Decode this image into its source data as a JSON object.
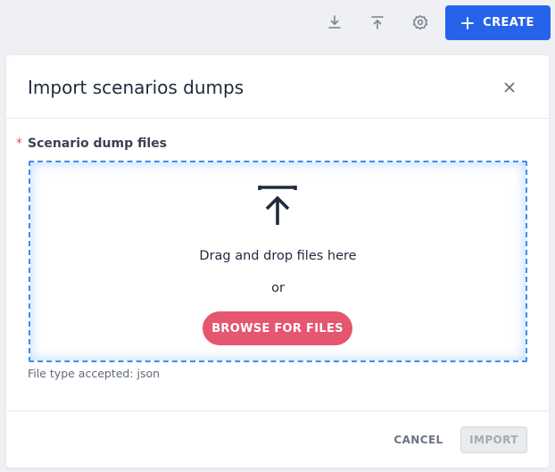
{
  "toolbar": {
    "download_icon": "download-icon",
    "upload_icon": "upload-icon",
    "settings_icon": "settings-icon",
    "create_label": "CREATE"
  },
  "dialog": {
    "title": "Import scenarios dumps",
    "field_label": "Scenario dump files",
    "required_marker": "*",
    "dropzone": {
      "drag_text": "Drag and drop files here",
      "or_text": "or",
      "browse_label": "BROWSE FOR FILES"
    },
    "hint": "File type accepted: json",
    "footer": {
      "cancel_label": "CANCEL",
      "import_label": "IMPORT"
    }
  },
  "colors": {
    "primary": "#2563eb",
    "browse": "#e5566f",
    "dropzone_border": "#3b8df5",
    "required": "#e0506c"
  }
}
